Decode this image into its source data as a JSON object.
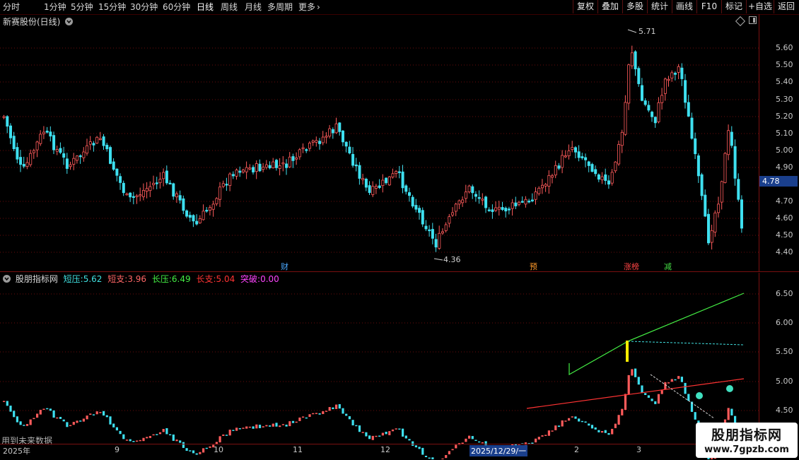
{
  "toolbar": {
    "periods": [
      "分时",
      "1分钟",
      "5分钟",
      "15分钟",
      "30分钟",
      "60分钟",
      "日线",
      "周线",
      "月线",
      "多周期",
      "更多"
    ],
    "active_period": "日线",
    "more_arrow": "›",
    "right_buttons": [
      "复权",
      "叠加",
      "多股",
      "统计",
      "画线",
      "F10",
      "标记",
      "+自选",
      "返回"
    ]
  },
  "main_panel": {
    "stock_title": "新赛股份(日线)",
    "y_labels": [
      "5.60",
      "5.50",
      "5.40",
      "5.30",
      "5.20",
      "5.10",
      "5.00",
      "4.90",
      "4.70",
      "4.60",
      "4.50",
      "4.40"
    ],
    "current_price": "4.78",
    "high_label": "5.71",
    "low_label": "4.36",
    "markers": [
      {
        "text": "财",
        "color": "#4aa8ff"
      },
      {
        "text": "预",
        "color": "#ff9a2a"
      },
      {
        "text": "涨榜",
        "color": "#ff4444"
      },
      {
        "text": "减",
        "color": "#44dd44"
      }
    ]
  },
  "indicator_panel": {
    "name": "股朋指标网",
    "items": [
      {
        "label": "短压:",
        "value": "5.62",
        "color": "#40e0e0"
      },
      {
        "label": "短支:",
        "value": "3.96",
        "color": "#ff6666"
      },
      {
        "label": "长压:",
        "value": "6.49",
        "color": "#44ee44"
      },
      {
        "label": "长支:",
        "value": "5.04",
        "color": "#ff3333"
      },
      {
        "label": "突破:",
        "value": "0.00",
        "color": "#ff44ff"
      }
    ],
    "y_labels": [
      "6.50",
      "6.00",
      "5.50",
      "5.00",
      "4.50"
    ],
    "footnote": "用到未来数据"
  },
  "date_axis": {
    "labels": [
      "2025年",
      "9",
      "10",
      "11",
      "12",
      "2025/12/29/一",
      "2",
      "3"
    ]
  },
  "watermark": {
    "title": "股朋指标网",
    "url": "www.7gpzb.com"
  },
  "colors": {
    "up": "#ff5b5b",
    "down": "#3ee0f0",
    "grid": "#6a0d0d",
    "axis": "#7a1010"
  }
}
